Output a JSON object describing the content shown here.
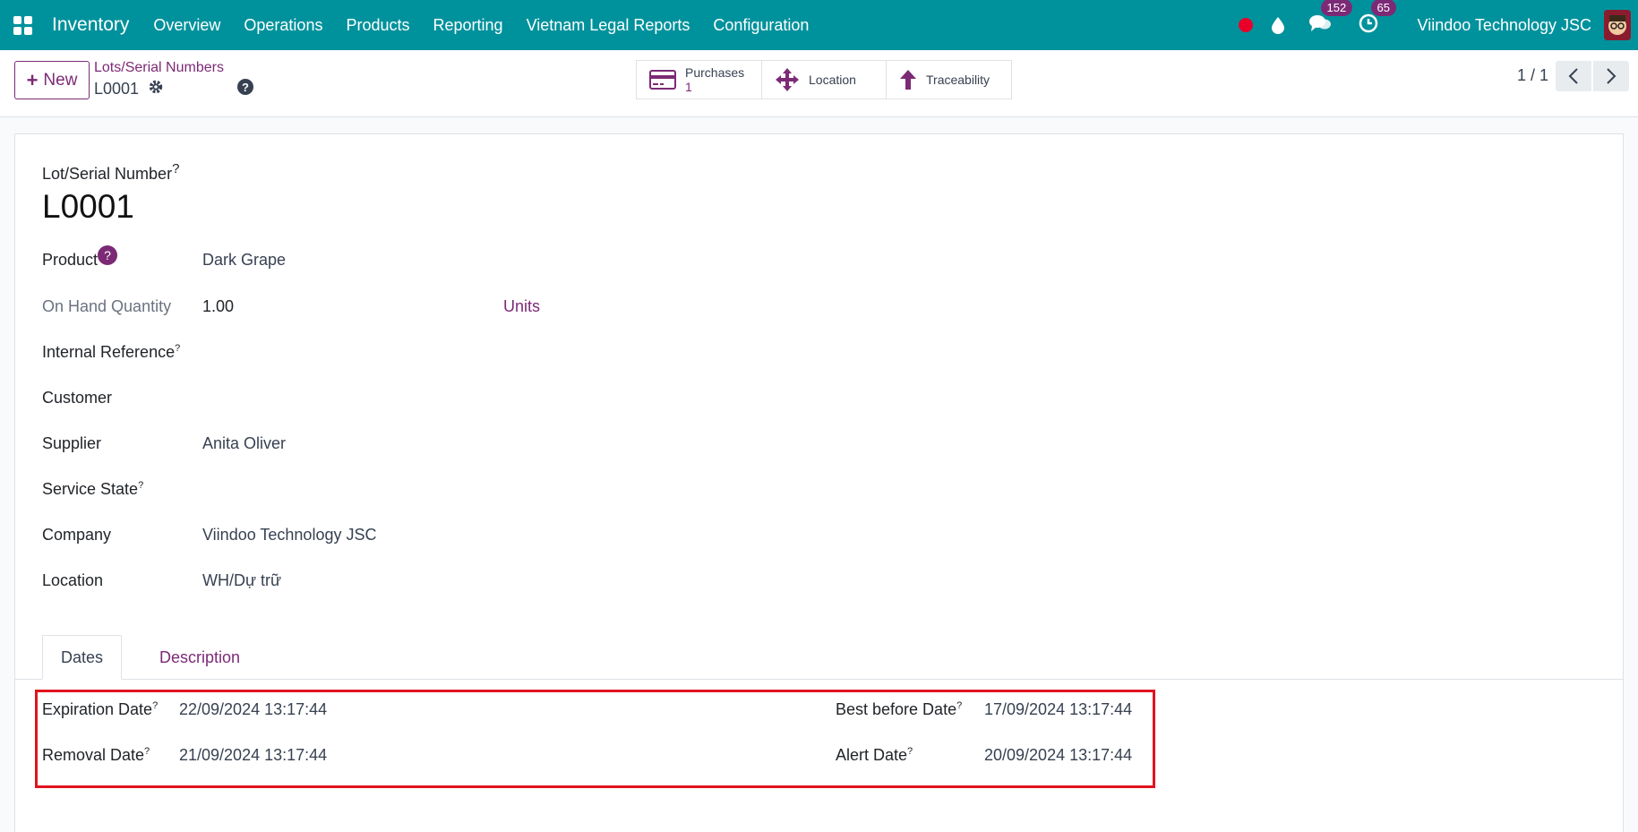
{
  "navbar": {
    "app_name": "Inventory",
    "menu": [
      "Overview",
      "Operations",
      "Products",
      "Reporting",
      "Vietnam Legal Reports",
      "Configuration"
    ],
    "messages_count": "152",
    "activities_count": "65",
    "company": "Viindoo Technology JSC"
  },
  "control_panel": {
    "new_label": "New",
    "breadcrumb": "Lots/Serial Numbers",
    "record_name": "L0001",
    "smart_buttons": {
      "purchases_label": "Purchases",
      "purchases_count": "1",
      "location_label": "Location",
      "traceability_label": "Traceability"
    },
    "pager": "1 / 1"
  },
  "form": {
    "title_label": "Lot/Serial Number",
    "title_value": "L0001",
    "product_label": "Product",
    "product_value": "Dark Grape",
    "on_hand_label": "On Hand Quantity",
    "on_hand_value": "1.00",
    "uom": "Units",
    "internal_ref_label": "Internal Reference",
    "customer_label": "Customer",
    "supplier_label": "Supplier",
    "supplier_value": "Anita Oliver",
    "service_state_label": "Service State",
    "company_label": "Company",
    "company_value": "Viindoo Technology JSC",
    "location_label": "Location",
    "location_value": "WH/Dự trữ"
  },
  "tabs": {
    "dates": "Dates",
    "description": "Description"
  },
  "dates": {
    "expiration_label": "Expiration Date",
    "expiration_value": "22/09/2024 13:17:44",
    "removal_label": "Removal Date",
    "removal_value": "21/09/2024 13:17:44",
    "best_before_label": "Best before Date",
    "best_before_value": "17/09/2024 13:17:44",
    "alert_label": "Alert Date",
    "alert_value": "20/09/2024 13:17:44"
  },
  "colors": {
    "navbar": "#00929c",
    "accent": "#7c2a76",
    "highlight": "#e0141e"
  }
}
